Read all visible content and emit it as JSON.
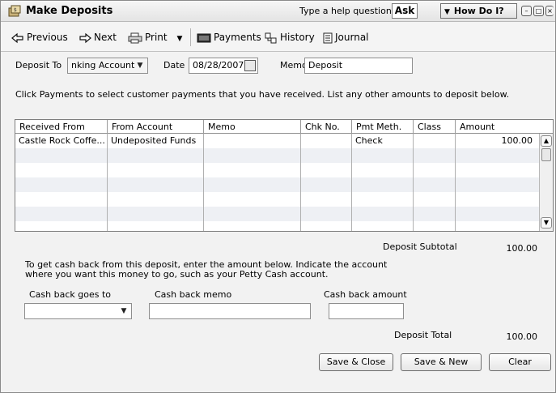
{
  "window": {
    "title": "Make Deposits",
    "help_prompt": "Type a help question",
    "ask_label": "Ask",
    "how_do_i_label": "How Do I?",
    "controls": [
      "minimize",
      "restore",
      "close"
    ]
  },
  "toolbar": {
    "previous_label": "Previous",
    "next_label": "Next",
    "print_label": "Print",
    "payments_label": "Payments",
    "history_label": "History",
    "journal_label": "Journal"
  },
  "form": {
    "deposit_to_label": "Deposit To",
    "deposit_to_value": "nking Account",
    "date_label": "Date",
    "date_value": "08/28/2007",
    "memo_label": "Memo",
    "memo_value": "Deposit",
    "instructions": "Click Payments to select customer payments that you have received. List any other amounts to deposit below."
  },
  "grid": {
    "columns": [
      "Received From",
      "From Account",
      "Memo",
      "Chk No.",
      "Pmt Meth.",
      "Class",
      "Amount"
    ],
    "rows": [
      {
        "received_from": "Castle Rock Coffe...",
        "from_account": "Undeposited Funds",
        "memo": "",
        "chk_no": "",
        "pmt_meth": "Check",
        "class": "",
        "amount": "100.00"
      }
    ]
  },
  "totals": {
    "subtotal_label": "Deposit Subtotal",
    "subtotal_value": "100.00",
    "total_label": "Deposit Total",
    "total_value": "100.00"
  },
  "cash_back": {
    "note_line1": "To get cash back from this deposit, enter the amount below.  Indicate the account",
    "note_line2": "where you want this money to go, such as your Petty Cash account.",
    "goes_to_label": "Cash back goes to",
    "goes_to_value": "",
    "memo_label": "Cash back memo",
    "memo_value": "",
    "amount_label": "Cash back amount",
    "amount_value": ""
  },
  "buttons": {
    "save_close": "Save & Close",
    "save_new": "Save & New",
    "clear": "Clear"
  },
  "colors": {
    "window_bg": "#f2f2f2",
    "grid_alt_row": "#eef0f4"
  }
}
